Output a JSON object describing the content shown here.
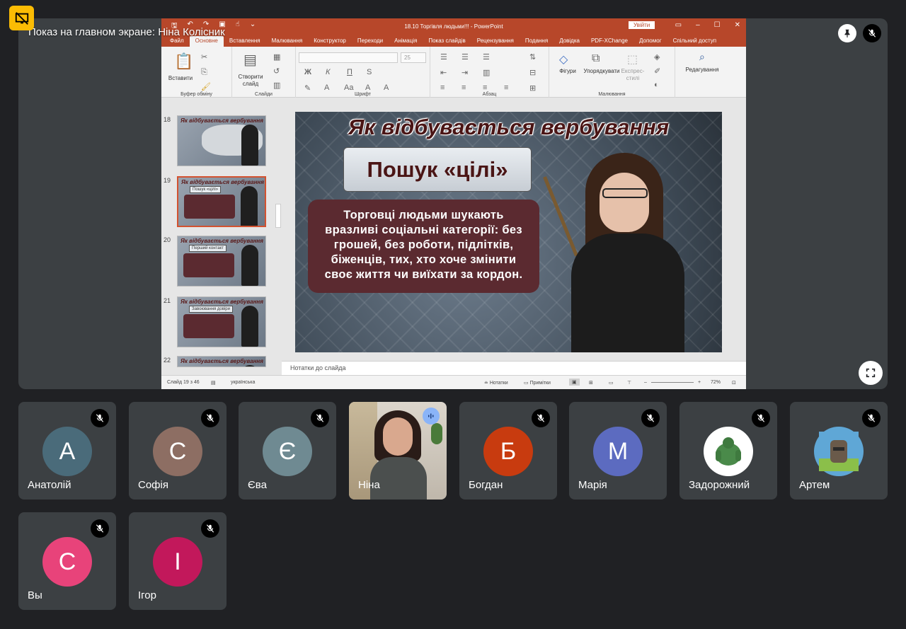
{
  "meet": {
    "presenting_label": "Показ на главном экране: Ніна Колісник"
  },
  "colors": {
    "accent": "#b7472a",
    "pin_bg": "#ffffff",
    "highlight": "#fbbc04"
  },
  "ppt": {
    "window_title": "18.10 Торгівля людьми!!! - PowerPoint",
    "signin_label": "Увійти",
    "tabs": [
      "Файл",
      "Основне",
      "Вставлення",
      "Малювання",
      "Конструктор",
      "Переходи",
      "Анімація",
      "Показ слайдів",
      "Рецензування",
      "Подання",
      "Довідка",
      "PDF-XChange",
      "Допомог",
      "Спільний доступ"
    ],
    "active_tab": "Основне",
    "ribbon": {
      "paste": "Вставити",
      "clipboard_group": "Буфер обміну",
      "new_slide": "Створити слайд",
      "slides_group": "Слайди",
      "font_group": "Шрифт",
      "font_size": "25",
      "paragraph_group": "Абзац",
      "shapes": "Фігури",
      "arrange": "Упорядкувати",
      "express_styles": "Експрес-стилі",
      "drawing_group": "Малювання",
      "editing": "Редагування",
      "bold": "Ж",
      "italic": "К",
      "underline": "П",
      "strike": "S"
    },
    "thumbnails": [
      {
        "num": "18",
        "title": "Як відбувається вербування",
        "sub": ""
      },
      {
        "num": "19",
        "title": "Як відбувається вербування",
        "sub": "Пошук «цілі»"
      },
      {
        "num": "20",
        "title": "Як відбувається вербування",
        "sub": "Перший контакт"
      },
      {
        "num": "21",
        "title": "Як відбувається вербування",
        "sub": "Завоювання довіри"
      },
      {
        "num": "22",
        "title": "Як відбувається вербування",
        "sub": ""
      }
    ],
    "slide": {
      "title": "Як відбувається вербування",
      "subtitle": "Пошук «цілі»",
      "body": "Торговці людьми шукають вразливі соціальні категорії: без грошей, без роботи, підлітків, біженців, тих, хто хоче змінити своє життя чи виїхати за кордон."
    },
    "notes_placeholder": "Нотатки до слайда",
    "status": {
      "slide_counter": "Слайд 19 з 46",
      "language": "українська",
      "notes_btn": "Нотатки",
      "comments_btn": "Примітки",
      "zoom": "72%"
    }
  },
  "participants": [
    {
      "name": "Анатолій",
      "initial": "А",
      "color": "#4a6b7a",
      "type": "initial"
    },
    {
      "name": "Софія",
      "initial": "С",
      "color": "#8d6e63",
      "type": "initial"
    },
    {
      "name": "Єва",
      "initial": "Є",
      "color": "#6f8a92",
      "type": "initial"
    },
    {
      "name": "Ніна",
      "initial": "",
      "color": "",
      "type": "video"
    },
    {
      "name": "Богдан",
      "initial": "Б",
      "color": "#c83b0f",
      "type": "initial"
    },
    {
      "name": "Марія",
      "initial": "М",
      "color": "#5c6bc0",
      "type": "initial"
    },
    {
      "name": "Задорожний",
      "initial": "",
      "color": "#ffffff",
      "type": "image"
    },
    {
      "name": "Артем",
      "initial": "",
      "color": "#5fa7d6",
      "type": "image"
    },
    {
      "name": "Вы",
      "initial": "С",
      "color": "#e8437a",
      "type": "initial"
    },
    {
      "name": "Ігор",
      "initial": "І",
      "color": "#c2185b",
      "type": "initial"
    }
  ]
}
